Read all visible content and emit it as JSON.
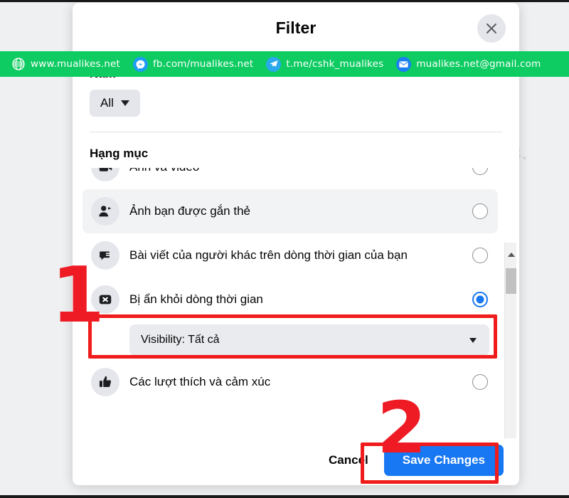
{
  "modal": {
    "title": "Filter",
    "close_icon": "close-icon",
    "year": {
      "label": "Năm",
      "selected": "All"
    },
    "category": {
      "heading": "Hạng mục",
      "items": [
        {
          "id": "photos-videos",
          "label": "Ảnh và video",
          "icon": "photo-video-icon",
          "selected": false,
          "hovered": false,
          "clipped": true
        },
        {
          "id": "tagged-photos",
          "label": "Ảnh bạn được gắn thẻ",
          "icon": "person-tag-icon",
          "selected": false,
          "hovered": true,
          "clipped": false
        },
        {
          "id": "posts-from-others",
          "label": "Bài viết của người khác trên dòng thời gian của bạn",
          "icon": "comment-bubble-icon",
          "selected": false,
          "hovered": false,
          "clipped": false
        },
        {
          "id": "hidden-from-timeline",
          "label": "Bị ẩn khỏi dòng thời gian",
          "icon": "x-square-icon",
          "selected": true,
          "hovered": false,
          "clipped": false
        },
        {
          "id": "likes-reactions",
          "label": "Các lượt thích và cảm xúc",
          "icon": "thumbs-up-icon",
          "selected": false,
          "hovered": false,
          "clipped": false
        }
      ],
      "visibility_select": {
        "label": "Visibility: Tất cả",
        "caret_icon": "chevron-down-icon"
      }
    },
    "footer": {
      "cancel_label": "Cancel",
      "save_label": "Save Changes"
    }
  },
  "scrollbar": {
    "up_icon": "scroll-up-arrow-icon",
    "down_icon": "scroll-down-arrow-icon",
    "thumb": "scrollbar-thumb"
  },
  "annotations": {
    "step_one": "1",
    "step_two": "2",
    "highlight_color": "#f01b1b"
  },
  "banner": {
    "background_color": "#0fcc62",
    "items": [
      {
        "icon": "globe-icon",
        "text": "www.mualikes.net"
      },
      {
        "icon": "messenger-icon",
        "text": "fb.com/mualikes.net"
      },
      {
        "icon": "telegram-icon",
        "text": "t.me/cshk_mualikes"
      },
      {
        "icon": "email-icon",
        "text": "mualikes.net@gmail.com"
      }
    ]
  },
  "backdrop": {
    "faint_text": "3."
  },
  "colors": {
    "accent_blue": "#1877f2",
    "banner_green": "#0fcc62",
    "annotation_red": "#f01b1b"
  }
}
